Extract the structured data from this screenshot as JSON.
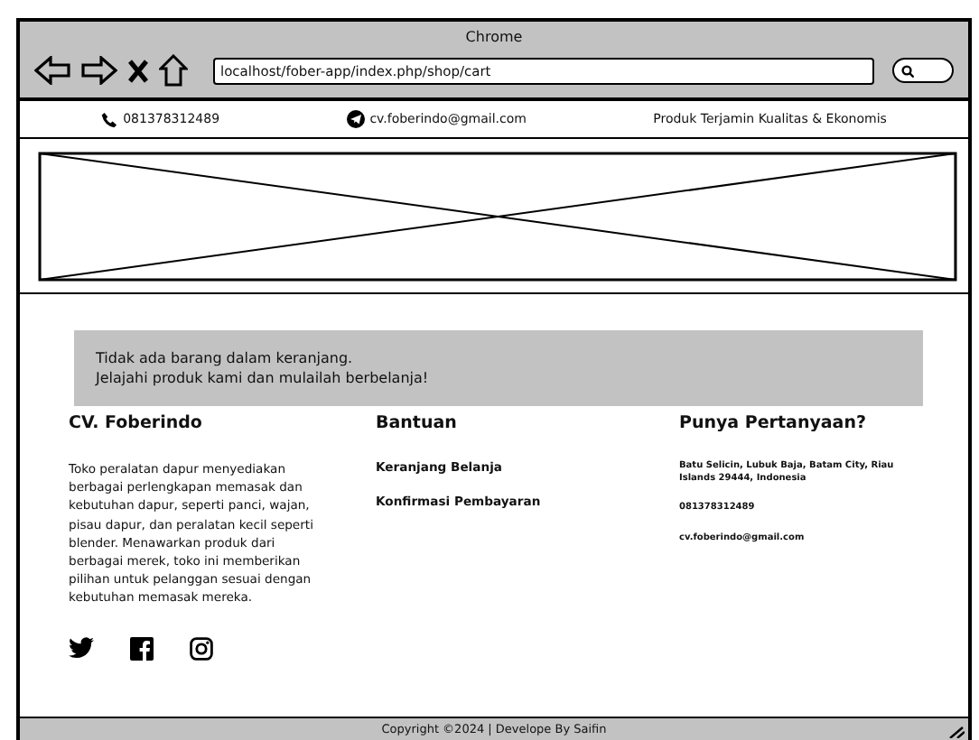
{
  "window": {
    "title": "Chrome"
  },
  "address_bar": {
    "value": "localhost/fober-app/index.php/shop/cart"
  },
  "top_bar": {
    "phone": "081378312489",
    "email": "cv.foberindo@gmail.com",
    "tagline": "Produk Terjamin Kualitas & Ekonomis"
  },
  "cart_message": {
    "lines": [
      "Tidak ada barang dalam keranjang.",
      "Jelajahi produk kami dan mulailah berbelanja!"
    ]
  },
  "footer": {
    "about": {
      "heading": "CV. Foberindo",
      "text": "Toko peralatan dapur menyediakan berbagai perlengkapan memasak dan kebutuhan dapur, seperti panci, wajan, pisau dapur, dan peralatan kecil seperti blender. Menawarkan produk dari berbagai merek, toko ini memberikan pilihan untuk pelanggan sesuai dengan kebutuhan memasak mereka."
    },
    "help": {
      "heading": "Bantuan",
      "links": [
        "Keranjang Belanja",
        "Konfirmasi Pembayaran"
      ]
    },
    "contact": {
      "heading": "Punya Pertanyaan?",
      "items": [
        "Batu Selicin, Lubuk Baja, Batam City, Riau Islands 29444, Indonesia",
        "081378312489",
        "cv.foberindo@gmail.com"
      ]
    }
  },
  "copyright": "Copyright ©2024 | Develope By Saifin"
}
